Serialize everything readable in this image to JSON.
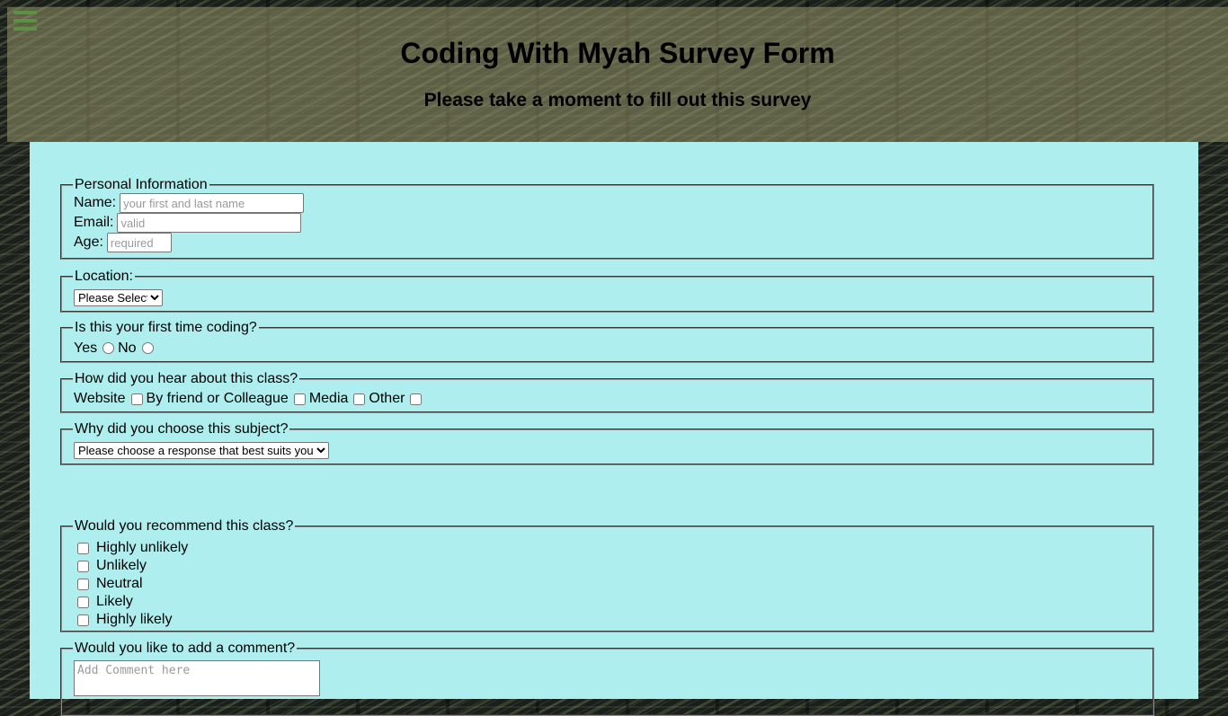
{
  "header": {
    "title": "Coding With Myah Survey Form",
    "subtitle": "Please take a moment to fill out this survey"
  },
  "personal": {
    "legend": "Personal Information",
    "name_label": "Name:",
    "name_placeholder": "your first and last name",
    "email_label": "Email:",
    "email_placeholder": "valid",
    "age_label": "Age:",
    "age_placeholder": "required"
  },
  "location": {
    "legend": "Location:",
    "selected": "Please Select"
  },
  "first_time": {
    "legend": "Is this your first time coding?",
    "yes": "Yes",
    "no": "No"
  },
  "heard": {
    "legend": "How did you hear about this class?",
    "options": [
      "Website",
      "By friend or Colleague",
      "Media",
      "Other"
    ]
  },
  "why": {
    "legend": "Why did you choose this subject?",
    "selected": "Please choose a response that best suits you"
  },
  "recommend": {
    "legend": "Would you recommend this class?",
    "options": [
      "Highly unlikely",
      "Unlikely",
      "Neutral",
      "Likely",
      "Highly likely"
    ]
  },
  "comment": {
    "legend": "Would you like to add a comment?",
    "placeholder": "Add Comment here"
  },
  "colors": {
    "main_bg": "#afeeee",
    "menu_icon": "#1a8a1a"
  },
  "icons": {
    "menu": "hamburger-menu-icon"
  }
}
